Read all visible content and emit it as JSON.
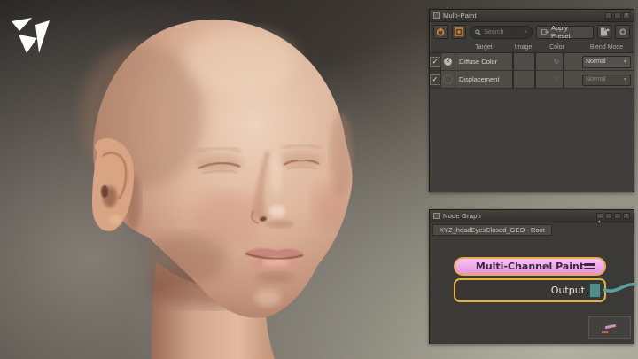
{
  "viewport": {
    "description": "3D head model, bald, eyes closed, three-quarter view",
    "logo_name": "xyz-triangles-logo",
    "skin_accent": "#ddb59c",
    "background_dark": "#242120",
    "background_light": "#98948a"
  },
  "multi_paint": {
    "title": "Multi-Paint",
    "controls": [
      "collapse",
      "float",
      "close"
    ],
    "toolbar": {
      "power_icon": "power",
      "target_icon": "paint-target",
      "search_placeholder": "Search",
      "clear_glyph": "×",
      "apply_preset_label": "Apply Preset",
      "document_icon": "document",
      "sync_icon": "sync-circle"
    },
    "columns": {
      "target": "Target",
      "image": "Image",
      "color": "Color",
      "blend": "Blend Mode"
    },
    "rows": [
      {
        "checked": "✓",
        "current": true,
        "target": "Diffuse Color",
        "image_hex": "#d9a183",
        "color1_hex": "#f2f1ec",
        "swap_icon": "↻",
        "color2_hex": "#f5f4f0",
        "blend_mode": "Normal"
      },
      {
        "checked": "✓",
        "current": false,
        "target": "Displacement",
        "image_hex": "#83908e",
        "color1_hex": "#6f706c",
        "swap_icon": "↻",
        "color2_hex": "#7c7d79",
        "blend_mode": "Normal"
      }
    ]
  },
  "node_graph": {
    "title": "Node Graph",
    "controls": [
      "snap",
      "collapse",
      "float",
      "close"
    ],
    "tab_label": "XYZ_headEyesClosed_GEO - Root",
    "paint_node": {
      "label": "Multi-Channel Paint",
      "fill_hex": "#e99ce2",
      "outline_hex": "#f0a74c"
    },
    "output_node": {
      "label": "Output",
      "outline_hex": "#e3b23f",
      "port_hex": "#4f8f8a"
    },
    "wire_hex": "#58a19b"
  }
}
